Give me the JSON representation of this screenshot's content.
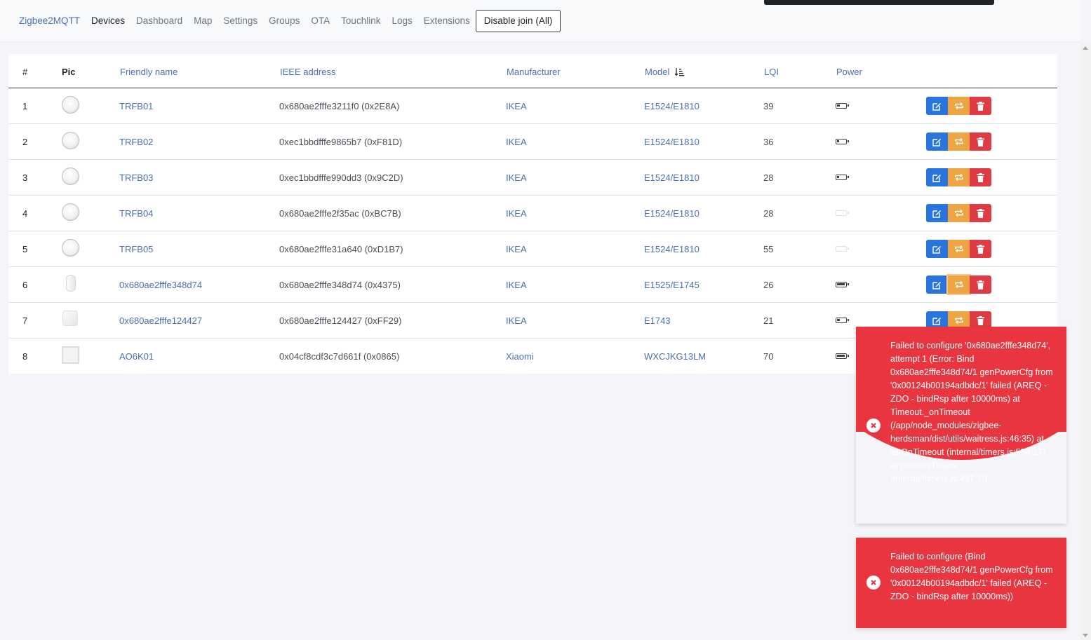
{
  "nav": {
    "brand": "Zigbee2MQTT",
    "items": [
      "Devices",
      "Dashboard",
      "Map",
      "Settings",
      "Groups",
      "OTA",
      "Touchlink",
      "Logs",
      "Extensions"
    ],
    "active": "Devices",
    "join_button": "Disable join (All)"
  },
  "table": {
    "headers": {
      "index": "#",
      "pic": "Pic",
      "friendly_name": "Friendly name",
      "ieee": "IEEE address",
      "manufacturer": "Manufacturer",
      "model": "Model",
      "lqi": "LQI",
      "power": "Power"
    },
    "sorted_column": "model",
    "rows": [
      {
        "n": "1",
        "name": "TRFB01",
        "ieee": "0x680ae2fffe3211f0 (0x2E8A)",
        "manufacturer": "IKEA",
        "model": "E1524/E1810",
        "lqi": "39",
        "pic": "round",
        "battery": 0.35
      },
      {
        "n": "2",
        "name": "TRFB02",
        "ieee": "0xec1bbdfffe9865b7 (0xF81D)",
        "manufacturer": "IKEA",
        "model": "E1524/E1810",
        "lqi": "36",
        "pic": "round",
        "battery": 0.25
      },
      {
        "n": "3",
        "name": "TRFB03",
        "ieee": "0xec1bbdfffe990dd3 (0x9C2D)",
        "manufacturer": "IKEA",
        "model": "E1524/E1810",
        "lqi": "28",
        "pic": "round",
        "battery": 0.25
      },
      {
        "n": "4",
        "name": "TRFB04",
        "ieee": "0x680ae2fffe2f35ac (0xBC7B)",
        "manufacturer": "IKEA",
        "model": "E1524/E1810",
        "lqi": "28",
        "pic": "round",
        "battery": 0
      },
      {
        "n": "5",
        "name": "TRFB05",
        "ieee": "0x680ae2fffe31a640 (0xD1B7)",
        "manufacturer": "IKEA",
        "model": "E1524/E1810",
        "lqi": "55",
        "pic": "round",
        "battery": 0
      },
      {
        "n": "6",
        "name": "0x680ae2fffe348d74",
        "ieee": "0x680ae2fffe348d74 (0x4375)",
        "manufacturer": "IKEA",
        "model": "E1525/E1745",
        "lqi": "26",
        "pic": "remote",
        "battery": 1.0
      },
      {
        "n": "7",
        "name": "0x680ae2fffe124427",
        "ieee": "0x680ae2fffe124427 (0xFF29)",
        "manufacturer": "IKEA",
        "model": "E1743",
        "lqi": "21",
        "pic": "square",
        "battery": 0.35
      },
      {
        "n": "8",
        "name": "AO6K01",
        "ieee": "0x04cf8cdf3c7d661f (0x0865)",
        "manufacturer": "Xiaomi",
        "model": "WXCJKG13LM",
        "lqi": "70",
        "pic": "panel",
        "battery": 1.0
      }
    ]
  },
  "toasts": [
    {
      "text": "Failed to configure '0x680ae2fffe348d74', attempt 1 (Error: Bind 0x680ae2fffe348d74/1 genPowerCfg from '0x00124b00194adbdc/1' failed (AREQ - ZDO - bindRsp after 10000ms) at Timeout._onTimeout (/app/node_modules/zigbee-herdsman/dist/utils/waitress.js:46:35) at listOnTimeout (internal/timers.js:554:17) at processTimers (internal/timers.js:497:7))"
    },
    {
      "text": "Failed to configure (Bind 0x680ae2fffe348d74/1 genPowerCfg from '0x00124b00194adbdc/1' failed (AREQ - ZDO - bindRsp after 10000ms))"
    }
  ],
  "colors": {
    "link": "#4a6fb5",
    "edit": "#2a74e0",
    "configure": "#eea442",
    "delete": "#de3b45",
    "toast": "#e9353f"
  },
  "icons": [
    "edit-icon",
    "refresh-icon",
    "trash-icon",
    "battery-icon",
    "error-circle-icon",
    "sort-icon"
  ]
}
